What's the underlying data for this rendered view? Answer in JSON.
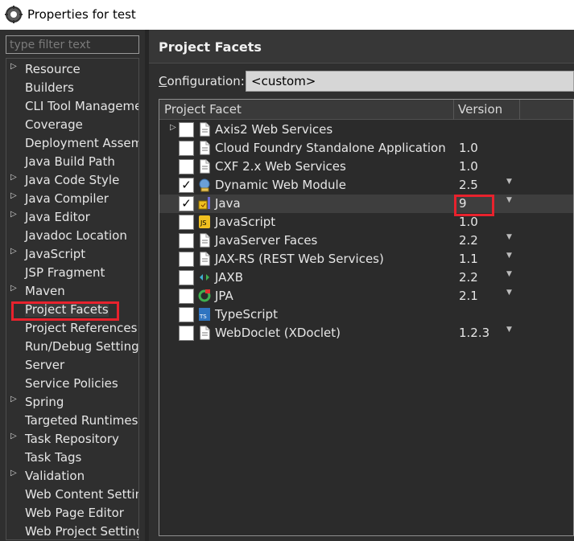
{
  "window": {
    "title": "Properties for test"
  },
  "filter": {
    "placeholder": "type filter text"
  },
  "sidebar": {
    "items": [
      {
        "label": "Resource",
        "expandable": true
      },
      {
        "label": "Builders",
        "expandable": false
      },
      {
        "label": "CLI Tool Manageme",
        "expandable": false
      },
      {
        "label": "Coverage",
        "expandable": false
      },
      {
        "label": "Deployment Assemb",
        "expandable": false
      },
      {
        "label": "Java Build Path",
        "expandable": false
      },
      {
        "label": "Java Code Style",
        "expandable": true
      },
      {
        "label": "Java Compiler",
        "expandable": true
      },
      {
        "label": "Java Editor",
        "expandable": true
      },
      {
        "label": "Javadoc Location",
        "expandable": false
      },
      {
        "label": "JavaScript",
        "expandable": true
      },
      {
        "label": "JSP Fragment",
        "expandable": false
      },
      {
        "label": "Maven",
        "expandable": true
      },
      {
        "label": "Project Facets",
        "expandable": false,
        "selected": true
      },
      {
        "label": "Project References",
        "expandable": false
      },
      {
        "label": "Run/Debug Settings",
        "expandable": false
      },
      {
        "label": "Server",
        "expandable": false
      },
      {
        "label": "Service Policies",
        "expandable": false
      },
      {
        "label": "Spring",
        "expandable": true
      },
      {
        "label": "Targeted Runtimes",
        "expandable": false
      },
      {
        "label": "Task Repository",
        "expandable": true
      },
      {
        "label": "Task Tags",
        "expandable": false
      },
      {
        "label": "Validation",
        "expandable": true
      },
      {
        "label": "Web Content Settin",
        "expandable": false
      },
      {
        "label": "Web Page Editor",
        "expandable": false
      },
      {
        "label": "Web Project Setting",
        "expandable": false
      }
    ]
  },
  "page": {
    "title": "Project Facets"
  },
  "configuration": {
    "label_prefix": "C",
    "label_rest": "onfiguration:",
    "value": "<custom>"
  },
  "table": {
    "headers": {
      "facet": "Project Facet",
      "version": "Version"
    },
    "rows": [
      {
        "name": "Axis2 Web Services",
        "version": "",
        "checked": false,
        "expandable": true,
        "icon": "document-icon",
        "dropdown": false
      },
      {
        "name": "Cloud Foundry Standalone Application",
        "version": "1.0",
        "checked": false,
        "expandable": false,
        "icon": "document-icon",
        "dropdown": false
      },
      {
        "name": "CXF 2.x Web Services",
        "version": "1.0",
        "checked": false,
        "expandable": false,
        "icon": "document-icon",
        "dropdown": false
      },
      {
        "name": "Dynamic Web Module",
        "version": "2.5",
        "checked": true,
        "expandable": false,
        "icon": "web-module-icon",
        "dropdown": true
      },
      {
        "name": "Java",
        "version": "9",
        "checked": true,
        "expandable": false,
        "icon": "java-icon",
        "dropdown": true,
        "highlighted": true
      },
      {
        "name": "JavaScript",
        "version": "1.0",
        "checked": false,
        "expandable": false,
        "icon": "javascript-icon",
        "dropdown": false
      },
      {
        "name": "JavaServer Faces",
        "version": "2.2",
        "checked": false,
        "expandable": false,
        "icon": "document-icon",
        "dropdown": true
      },
      {
        "name": "JAX-RS (REST Web Services)",
        "version": "1.1",
        "checked": false,
        "expandable": false,
        "icon": "document-icon",
        "dropdown": true
      },
      {
        "name": "JAXB",
        "version": "2.2",
        "checked": false,
        "expandable": false,
        "icon": "jaxb-icon",
        "dropdown": true
      },
      {
        "name": "JPA",
        "version": "2.1",
        "checked": false,
        "expandable": false,
        "icon": "jpa-icon",
        "dropdown": true
      },
      {
        "name": "TypeScript",
        "version": "",
        "checked": false,
        "expandable": false,
        "icon": "typescript-icon",
        "dropdown": false
      },
      {
        "name": "WebDoclet (XDoclet)",
        "version": "1.2.3",
        "checked": false,
        "expandable": false,
        "icon": "document-icon",
        "dropdown": true
      }
    ]
  },
  "colors": {
    "highlight_box": "#e8222d",
    "panel_bg": "#2f2f2f",
    "text": "#e6e6e6"
  }
}
